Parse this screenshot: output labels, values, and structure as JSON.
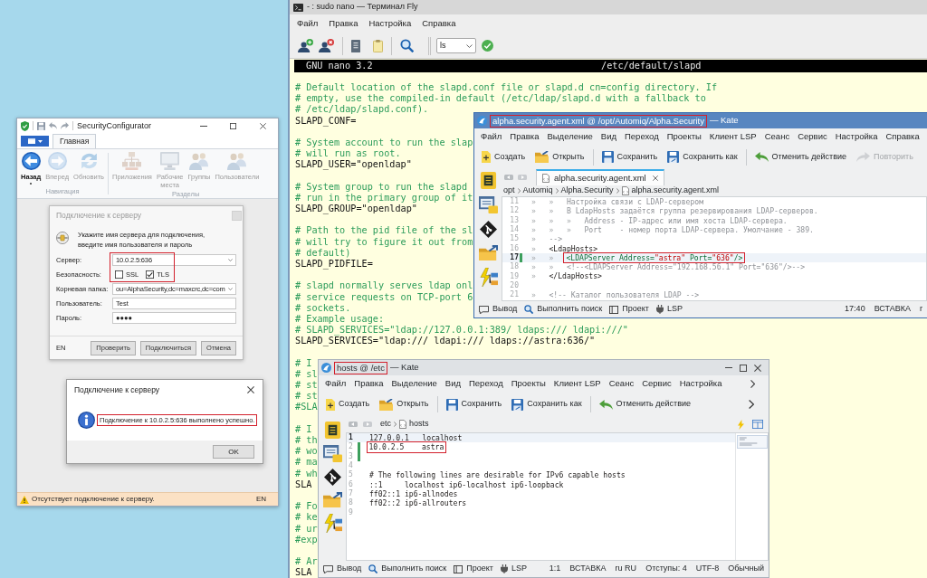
{
  "security_configurator": {
    "title": "SecurityConfigurator",
    "ribbon_tabs": [
      {
        "label": "Главная",
        "selected": true
      }
    ],
    "ribbon_groups": [
      {
        "label": "Навигация",
        "buttons": [
          {
            "label": "Назад",
            "disabled": false,
            "dropdown": true
          },
          {
            "label": "Вперед",
            "disabled": true,
            "dropdown": false
          },
          {
            "label": "Обновить",
            "disabled": true,
            "dropdown": false
          }
        ]
      },
      {
        "label": "Разделы",
        "buttons": [
          {
            "label": "Приложения",
            "disabled": true,
            "dropdown": false
          },
          {
            "label": "Рабочие места",
            "disabled": true,
            "dropdown": false
          },
          {
            "label": "Группы",
            "disabled": true,
            "dropdown": false
          },
          {
            "label": "Пользователи",
            "disabled": true,
            "dropdown": false
          }
        ]
      }
    ],
    "connect_dialog": {
      "title": "Подключение к серверу",
      "prompt": "Укажите имя сервера для подключения, введите имя пользователя и пароль",
      "fields": [
        {
          "label": "Сервер:",
          "kind": "combo",
          "value": "10.0.2.5:636",
          "highlighted": true
        },
        {
          "label": "Безопасность:",
          "kind": "checks",
          "options": [
            {
              "label": "SSL",
              "checked": false
            },
            {
              "label": "TLS",
              "checked": true
            }
          ],
          "highlighted": true
        },
        {
          "label": "Корневая папка:",
          "kind": "combo",
          "value": "ou=AlphaSecurity,dc=maxcrc,dc=com",
          "highlighted": false
        },
        {
          "label": "Пользователь:",
          "kind": "text",
          "value": "Test",
          "highlighted": false
        },
        {
          "label": "Пароль:",
          "kind": "text",
          "value": "●●●●",
          "highlighted": false
        }
      ],
      "language": "EN",
      "buttons": [
        "Проверить",
        "Подключиться",
        "Отмена"
      ]
    },
    "result_dialog": {
      "title": "Подключение к серверу",
      "message": "Подключение к 10.0.2.5:636 выполнено успешно.",
      "highlighted": true,
      "button": "OK"
    },
    "status_bar": {
      "message": "Отсутствует подключение к серверу.",
      "language": "EN"
    }
  },
  "terminal": {
    "title": "- : sudo nano — Терминал Fly",
    "menu": [
      "Файл",
      "Правка",
      "Настройка",
      "Справка"
    ],
    "command": "ls",
    "nano_header": {
      "version": "GNU nano 3.2",
      "file": "/etc/default/slapd"
    },
    "lines": [
      {
        "kind": "comment",
        "text": "# Default location of the slapd.conf file or slapd.d cn=config directory. If"
      },
      {
        "kind": "comment",
        "text": "# empty, use the compiled-in default (/etc/ldap/slapd.d with a fallback to"
      },
      {
        "kind": "comment",
        "text": "# /etc/ldap/slapd.conf)."
      },
      {
        "kind": "code",
        "text": "SLAPD_CONF="
      },
      {
        "kind": "blank"
      },
      {
        "kind": "comment",
        "text": "# System account to run the slap"
      },
      {
        "kind": "comment",
        "text": "# will run as root."
      },
      {
        "kind": "code",
        "text": "SLAPD_USER=\"openldap\""
      },
      {
        "kind": "blank"
      },
      {
        "kind": "comment",
        "text": "# System group to run the slapd"
      },
      {
        "kind": "comment",
        "text": "# run in the primary group of it"
      },
      {
        "kind": "code",
        "text": "SLAPD_GROUP=\"openldap\""
      },
      {
        "kind": "blank"
      },
      {
        "kind": "comment",
        "text": "# Path to the pid file of the sl"
      },
      {
        "kind": "comment",
        "text": "# will try to figure it out from"
      },
      {
        "kind": "comment",
        "text": "# default)"
      },
      {
        "kind": "code",
        "text": "SLAPD_PIDFILE="
      },
      {
        "kind": "blank"
      },
      {
        "kind": "comment",
        "text": "# slapd normally serves ldap onl"
      },
      {
        "kind": "comment",
        "text": "# service requests on TCP-port 6"
      },
      {
        "kind": "comment",
        "text": "# sockets."
      },
      {
        "kind": "comment",
        "text": "# Example usage:"
      },
      {
        "kind": "comment",
        "text": "# SLAPD_SERVICES=\"ldap://127.0.0.1:389/ ldaps:/// ldapi:///\""
      },
      {
        "kind": "code",
        "text": "SLAPD_SERVICES=\"ldap:/// ldapi:/// ldaps://astra:636/\""
      },
      {
        "kind": "blank"
      },
      {
        "kind": "comment",
        "text": "# I"
      },
      {
        "kind": "comment",
        "text": "# sl"
      },
      {
        "kind": "comment",
        "text": "# st"
      },
      {
        "kind": "comment",
        "text": "# st"
      },
      {
        "kind": "comment",
        "text": "#SLA"
      },
      {
        "kind": "blank"
      },
      {
        "kind": "comment",
        "text": "# I"
      },
      {
        "kind": "comment",
        "text": "# th"
      },
      {
        "kind": "comment",
        "text": "# wo"
      },
      {
        "kind": "comment",
        "text": "# ma"
      },
      {
        "kind": "comment",
        "text": "# wh"
      },
      {
        "kind": "code",
        "text": "SLA"
      },
      {
        "kind": "blank"
      },
      {
        "kind": "comment",
        "text": "# Fo"
      },
      {
        "kind": "comment",
        "text": "# ke"
      },
      {
        "kind": "comment",
        "text": "# ur"
      },
      {
        "kind": "comment",
        "text": "#exp"
      },
      {
        "kind": "blank"
      },
      {
        "kind": "comment",
        "text": "# Ar"
      },
      {
        "kind": "code",
        "text": "SLA"
      }
    ]
  },
  "kate_windows": [
    {
      "title": "alpha.security.agent.xml @ /opt/Automiq/Alpha.Security",
      "app": "— Kate",
      "active": true,
      "highlighted": true,
      "window_buttons": false,
      "menu": [
        "Файл",
        "Правка",
        "Выделение",
        "Вид",
        "Переход",
        "Проекты",
        "Клиент LSP",
        "Сеанс",
        "Сервис",
        "Настройка",
        "Справка"
      ],
      "menu_overflow": false,
      "toolbar": [
        [
          {
            "label": "Создать",
            "disabled": false
          },
          {
            "label": "Открыть",
            "disabled": false
          }
        ],
        [
          {
            "label": "Сохранить",
            "disabled": false
          },
          {
            "label": "Сохранить как",
            "disabled": false
          }
        ],
        [
          {
            "label": "Отменить действие",
            "disabled": false
          },
          {
            "label": "Повторить",
            "disabled": true
          }
        ]
      ],
      "toolbar_overflow": false,
      "tabs": [
        {
          "label": "alpha.security.agent.xml",
          "selected": true
        }
      ],
      "breadcrumb": [
        "opt",
        "Automiq",
        "Alpha.Security",
        "alpha.security.agent.xml"
      ],
      "lines": [
        {
          "number": "11",
          "indent": "»   »   ",
          "text": "Настройка связи с LDAP-сервером",
          "kind": "comment",
          "current": false,
          "modified": false,
          "highlighted": false
        },
        {
          "number": "12",
          "indent": "»   »   ",
          "text": "В LdapHosts задаётся группа резервирования LDAP-серверов.",
          "kind": "comment",
          "current": false,
          "modified": false,
          "highlighted": false
        },
        {
          "number": "13",
          "indent": "»   »   »   ",
          "text": "Address - IP-адрес или имя хоста LDAP-сервера.",
          "kind": "comment",
          "current": false,
          "modified": false,
          "highlighted": false
        },
        {
          "number": "14",
          "indent": "»   »   »   ",
          "text": "Port    - номер порта LDAP-сервера. Умолчание - 389.",
          "kind": "comment",
          "current": false,
          "modified": false,
          "highlighted": false
        },
        {
          "number": "15",
          "indent": "»   ",
          "text": "-->",
          "kind": "comment",
          "current": false,
          "modified": false,
          "highlighted": false
        },
        {
          "number": "16",
          "indent": "»   ",
          "text": "<LdapHosts>",
          "kind": "tag",
          "current": false,
          "modified": false,
          "highlighted": false
        },
        {
          "number": "17",
          "indent": "»   »   ",
          "segments": [
            {
              "text": "<LDAPServer Address=",
              "kind": "attr"
            },
            {
              "text": "\"astra\"",
              "kind": "value"
            },
            {
              "text": " Port=",
              "kind": "attr"
            },
            {
              "text": "\"636\"",
              "kind": "value"
            },
            {
              "text": "/>",
              "kind": "attr"
            }
          ],
          "current": true,
          "modified": true,
          "highlighted": true
        },
        {
          "number": "18",
          "indent": "»   »   ",
          "text": "<!--<LDAPServer Address=\"192.168.56.1\" Port=\"636\"/>-->",
          "kind": "comment",
          "current": false,
          "modified": false,
          "highlighted": false
        },
        {
          "number": "19",
          "indent": "»   ",
          "text": "</LdapHosts>",
          "kind": "tag",
          "current": false,
          "modified": false,
          "highlighted": false
        },
        {
          "number": "20",
          "current": false,
          "modified": false,
          "highlighted": false
        },
        {
          "number": "21",
          "indent": "»   ",
          "text": "<!-- Каталог пользователя LDAP -->",
          "kind": "comment",
          "current": false,
          "modified": false,
          "highlighted": false
        }
      ],
      "status_left": [
        "Вывод",
        "Выполнить поиск",
        "Проект",
        "LSP"
      ],
      "status_right": [
        "17:40",
        "ВСТАВКА",
        "r"
      ]
    },
    {
      "title": "hosts @ /etc",
      "app": "— Kate",
      "active": false,
      "highlighted": true,
      "window_buttons": true,
      "menu": [
        "Файл",
        "Правка",
        "Выделение",
        "Вид",
        "Переход",
        "Проекты",
        "Клиент LSP",
        "Сеанс",
        "Сервис",
        "Настройка"
      ],
      "menu_overflow": true,
      "toolbar": [
        [
          {
            "label": "Создать",
            "disabled": false
          },
          {
            "label": "Открыть",
            "disabled": false
          }
        ],
        [
          {
            "label": "Сохранить",
            "disabled": false
          },
          {
            "label": "Сохранить как",
            "disabled": false
          }
        ],
        [
          {
            "label": "Отменить действие",
            "disabled": false
          }
        ]
      ],
      "toolbar_overflow": true,
      "breadcrumb": [
        "etc",
        "hosts"
      ],
      "lines": [
        {
          "number": "1",
          "text": "127.0.0.1   localhost",
          "kind": "plain",
          "current": true,
          "modified": false,
          "highlighted": false
        },
        {
          "number": "2",
          "text": "10.0.2.5    astra",
          "kind": "plain",
          "current": false,
          "modified": true,
          "highlighted": true
        },
        {
          "number": "3",
          "current": false,
          "modified": true,
          "highlighted": false
        },
        {
          "number": "4",
          "current": false,
          "modified": false,
          "highlighted": false
        },
        {
          "number": "5",
          "text": "# The following lines are desirable for IPv6 capable hosts",
          "kind": "plain",
          "current": false,
          "modified": false,
          "highlighted": false
        },
        {
          "number": "6",
          "text": "::1     localhost ip6-localhost ip6-loopback",
          "kind": "plain",
          "current": false,
          "modified": false,
          "highlighted": false
        },
        {
          "number": "7",
          "text": "ff02::1 ip6-allnodes",
          "kind": "plain",
          "current": false,
          "modified": false,
          "highlighted": false
        },
        {
          "number": "8",
          "text": "ff02::2 ip6-allrouters",
          "kind": "plain",
          "current": false,
          "modified": false,
          "highlighted": false
        },
        {
          "number": "9",
          "current": false,
          "modified": false,
          "highlighted": false
        }
      ],
      "status_left": [
        "Вывод",
        "Выполнить поиск",
        "Проект",
        "LSP"
      ],
      "status_right": [
        "1:1",
        "ВСТАВКА",
        "ru RU",
        "Отступы: 4",
        "UTF-8",
        "Обычный"
      ]
    }
  ]
}
